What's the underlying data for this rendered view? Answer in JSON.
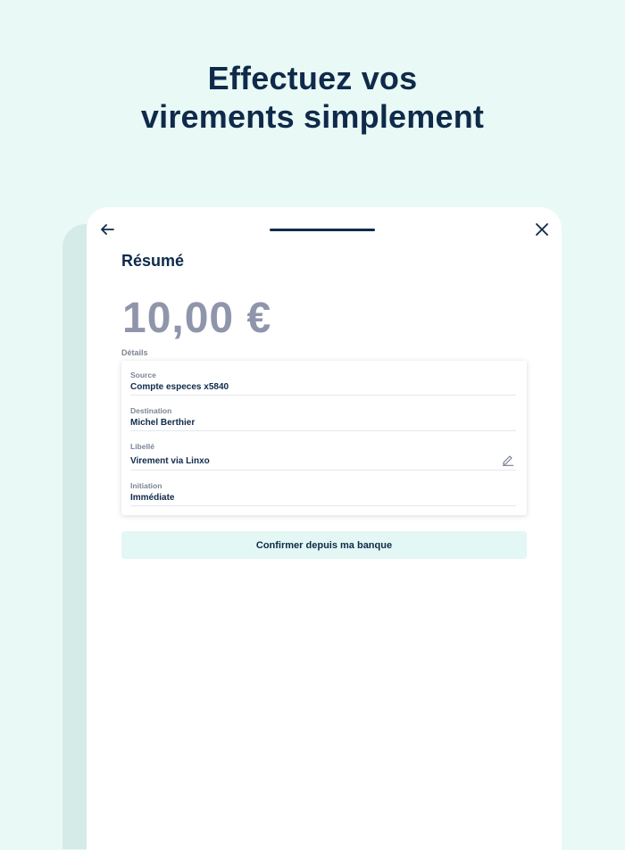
{
  "headline": {
    "line1": "Effectuez vos",
    "line2": "virements simplement"
  },
  "header": {
    "back_icon": "arrow-left-icon",
    "close_icon": "close-icon"
  },
  "summary": {
    "title": "Résumé",
    "amount": "10,00 €",
    "details_label": "Détails",
    "fields": [
      {
        "label": "Source",
        "value": "Compte especes x5840"
      },
      {
        "label": "Destination",
        "value": "Michel Berthier"
      },
      {
        "label": "Libellé",
        "value": "Virement via Linxo",
        "icon": "pencil-icon"
      },
      {
        "label": "Initiation",
        "value": "Immédiate"
      }
    ]
  },
  "actions": {
    "confirm_label": "Confirmer depuis ma banque"
  },
  "colors": {
    "background": "#e9f9f5",
    "primary_text": "#0f2a4a",
    "amount": "#8f95ab",
    "button_bg": "#e3f7f4"
  }
}
